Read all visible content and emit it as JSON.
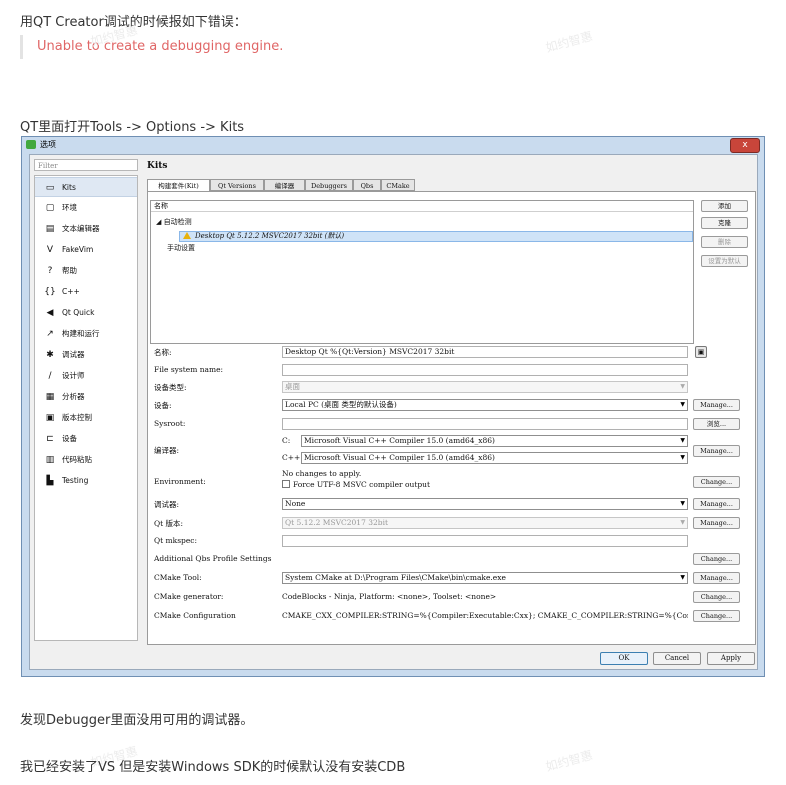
{
  "article": {
    "intro": "用QT Creator调试的时候报如下错误：",
    "error_quote": "Unable to create a debugging engine.",
    "path_line": "QT里面打开Tools -> Options -> Kits",
    "finding": "发现Debugger里面没用可用的调试器。",
    "conclusion": "我已经安装了VS 但是安装Windows SDK的时候默认没有安装CDB",
    "watermark": "如约智惠"
  },
  "dialog": {
    "title": "选项",
    "close_label": "x",
    "filter_placeholder": "Filter",
    "sidebar": [
      {
        "label": "Kits",
        "icon": "monitor-icon",
        "glyph": "▭"
      },
      {
        "label": "环境",
        "icon": "desktop-icon",
        "glyph": "▢"
      },
      {
        "label": "文本编辑器",
        "icon": "text-editor-icon",
        "glyph": "▤"
      },
      {
        "label": "FakeVim",
        "icon": "fakevim-icon",
        "glyph": "V"
      },
      {
        "label": "帮助",
        "icon": "help-icon",
        "glyph": "?"
      },
      {
        "label": "C++",
        "icon": "braces-icon",
        "glyph": "{}"
      },
      {
        "label": "Qt Quick",
        "icon": "arrow-icon",
        "glyph": "◀"
      },
      {
        "label": "构建和运行",
        "icon": "hammer-icon",
        "glyph": "↗"
      },
      {
        "label": "调试器",
        "icon": "bug-icon",
        "glyph": "✱"
      },
      {
        "label": "设计师",
        "icon": "pen-icon",
        "glyph": "/"
      },
      {
        "label": "分析器",
        "icon": "analyzer-icon",
        "glyph": "▦"
      },
      {
        "label": "版本控制",
        "icon": "version-control-icon",
        "glyph": "▣"
      },
      {
        "label": "设备",
        "icon": "device-icon",
        "glyph": "⊏"
      },
      {
        "label": "代码粘贴",
        "icon": "code-paste-icon",
        "glyph": "▥"
      },
      {
        "label": "Testing",
        "icon": "testing-icon",
        "glyph": "▙"
      }
    ],
    "section_title": "Kits",
    "tabs": [
      "构建套件(Kit)",
      "Qt Versions",
      "编译器",
      "Debuggers",
      "Qbs",
      "CMake"
    ],
    "tree": {
      "header": "名称",
      "auto_group": "自动检测",
      "selected_kit": "Desktop Qt 5.12.2 MSVC2017 32bit (默认)",
      "manual_group": "手动设置"
    },
    "side_buttons": {
      "add": "添加",
      "clone": "克隆",
      "remove": "删除",
      "set_default": "设置为默认"
    },
    "form": {
      "name_label": "名称:",
      "name_value": "Desktop Qt %{Qt:Version} MSVC2017 32bit",
      "filesystem_label": "File system name:",
      "device_type_label": "设备类型:",
      "device_type_value": "桌面",
      "device_label": "设备:",
      "device_value": "Local PC (桌面 类型的默认设备)",
      "sysroot_label": "Sysroot:",
      "browse_label": "浏览...",
      "compiler_label": "编译器:",
      "c_label": "C:",
      "c_value": "Microsoft Visual C++ Compiler 15.0 (amd64_x86)",
      "cpp_label": "C++:",
      "cpp_value": "Microsoft Visual C++ Compiler 15.0 (amd64_x86)",
      "environment_label": "Environment:",
      "environment_value": "No changes to apply.",
      "utf8_label": "Force UTF-8 MSVC compiler output",
      "debugger_label": "调试器:",
      "debugger_value": "None",
      "qt_version_label": "Qt 版本:",
      "qt_version_value": "Qt 5.12.2 MSVC2017 32bit",
      "mkspec_label": "Qt mkspec:",
      "qbs_label": "Additional Qbs Profile Settings",
      "cmake_tool_label": "CMake Tool:",
      "cmake_tool_value": "System CMake at D:\\Program Files\\CMake\\bin\\cmake.exe",
      "cmake_gen_label": "CMake generator:",
      "cmake_gen_value": "CodeBlocks - Ninja, Platform: <none>, Toolset: <none>",
      "cmake_conf_label": "CMake Configuration",
      "cmake_conf_value": "CMAKE_CXX_COMPILER:STRING=%{Compiler:Executable:Cxx}; CMAKE_C_COMPILER:STRING=%{Compiler:Executable:…",
      "manage": "Manage...",
      "change": "Change..."
    },
    "footer": {
      "ok": "OK",
      "cancel": "Cancel",
      "apply": "Apply"
    }
  }
}
